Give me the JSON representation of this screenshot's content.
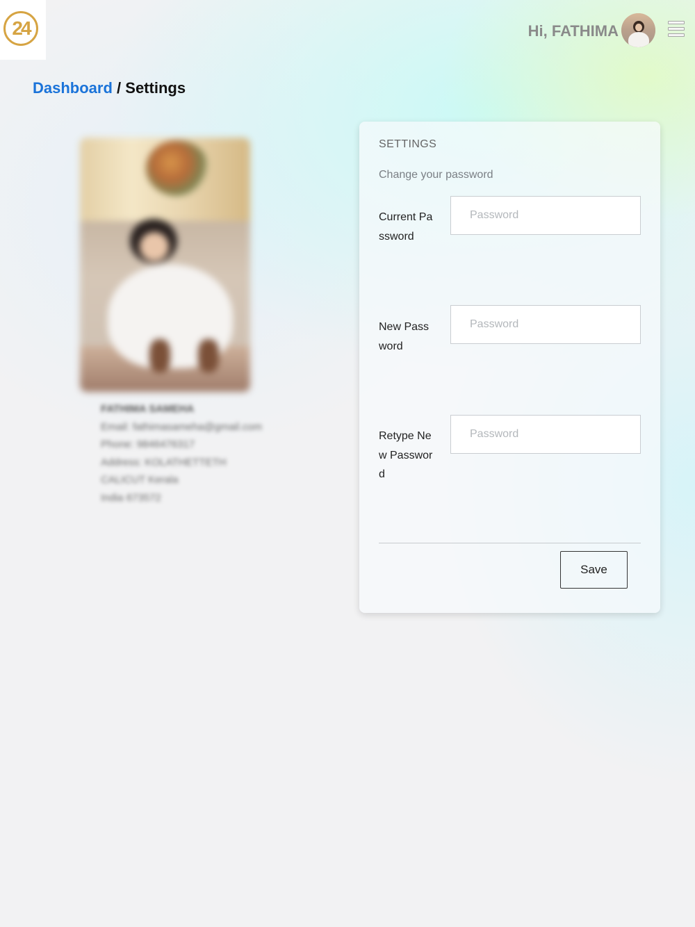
{
  "header": {
    "logo_text": "24",
    "greeting": "Hi, FATHIMA",
    "avatar_icon": "user-avatar",
    "menu_icon": "hamburger-menu-icon"
  },
  "breadcrumb": {
    "home": "Dashboard",
    "separator": " / ",
    "current": "Settings"
  },
  "profile": {
    "name": "FATHIMA SAMEHA",
    "email": "Email: fathimasameha@gmail.com",
    "phone": "Phone: 9846476317",
    "address": "Address: KOLATHETTETH",
    "city": "CALICUT Kerala",
    "country": "India 673572"
  },
  "settings": {
    "title": "SETTINGS",
    "subtitle": "Change your password",
    "fields": [
      {
        "label": "Current Password",
        "placeholder": "Password",
        "value": ""
      },
      {
        "label": "New Password",
        "placeholder": "Password",
        "value": ""
      },
      {
        "label": "Retype New Password",
        "placeholder": "Password",
        "value": ""
      }
    ],
    "save_label": "Save"
  },
  "colors": {
    "link": "#1a73d9",
    "logo": "#d6a443",
    "greeting": "#8a8a8a"
  }
}
